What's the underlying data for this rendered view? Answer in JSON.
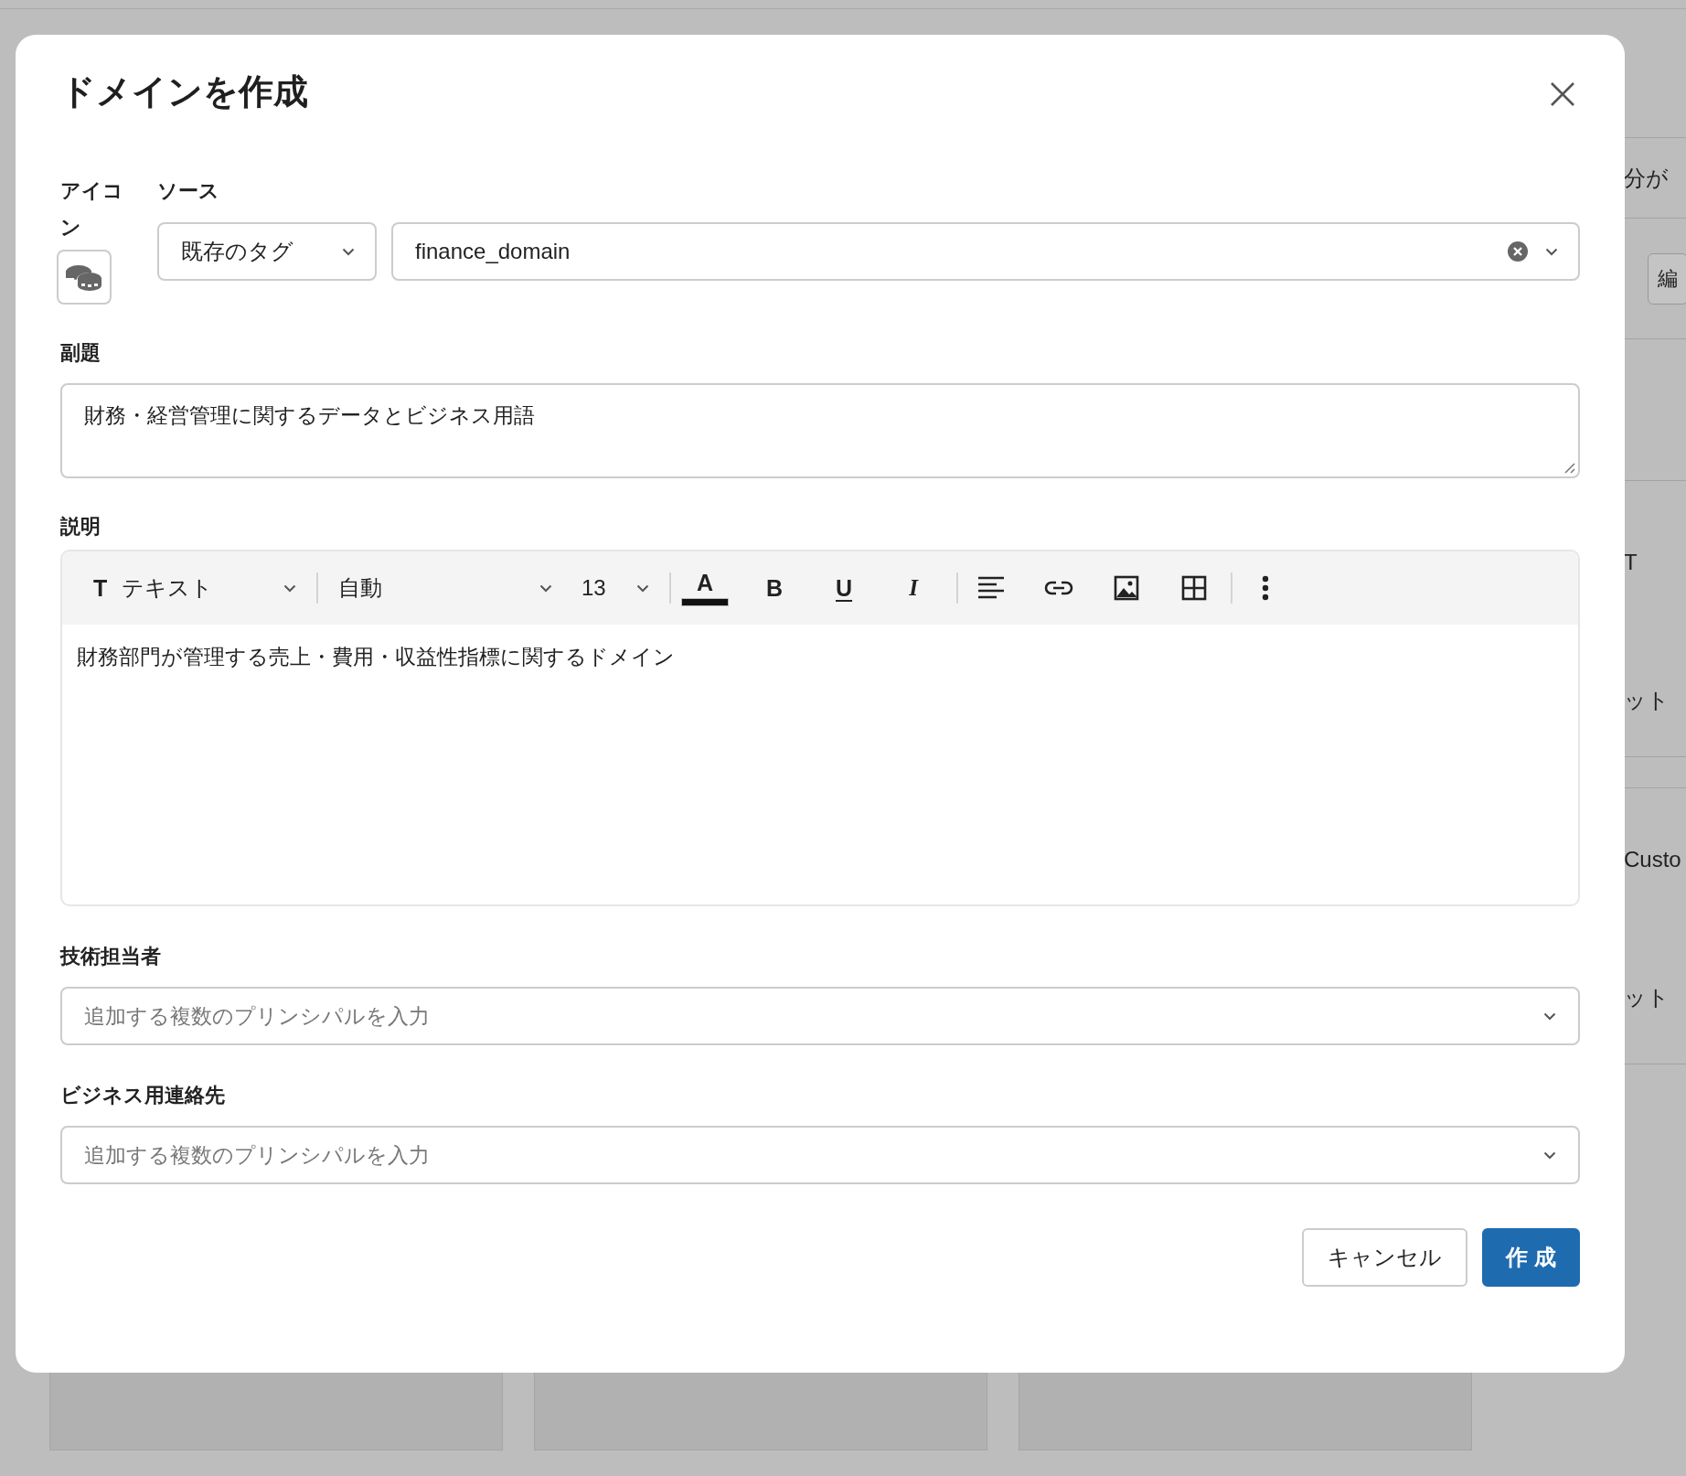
{
  "background_page": {
    "side_items": [
      {
        "kind": "text",
        "text": "分が"
      },
      {
        "kind": "button",
        "text": "編"
      },
      {
        "kind": "blank"
      },
      {
        "kind": "text",
        "text": "T"
      },
      {
        "kind": "text",
        "text": "ット"
      },
      {
        "kind": "blank"
      },
      {
        "kind": "text",
        "text": "Custo"
      },
      {
        "kind": "text",
        "text": "ット"
      }
    ],
    "cards": [
      {
        "kind": "card"
      },
      {
        "kind": "card"
      },
      {
        "kind": "card"
      }
    ]
  },
  "dialog": {
    "title": "ドメインを作成",
    "icon_label": "アイコン",
    "source_label": "ソース",
    "source_select": {
      "value": "既存のタグ"
    },
    "tag_field": {
      "value": "finance_domain"
    },
    "subtitle": {
      "label": "副題",
      "value": "財務・経営管理に関するデータとビジネス用語"
    },
    "description": {
      "label": "説明",
      "toolbar": [
        {
          "kind": "dropdown",
          "glyph": "T",
          "label": "テキスト"
        },
        {
          "kind": "dropdown",
          "label": "自動"
        },
        {
          "kind": "dropdown",
          "label": "13"
        },
        {
          "kind": "color",
          "glyph": "A"
        },
        {
          "kind": "bold",
          "glyph": "B"
        },
        {
          "kind": "underline",
          "glyph": "U"
        },
        {
          "kind": "italic",
          "glyph": "I"
        },
        {
          "kind": "align"
        },
        {
          "kind": "link"
        },
        {
          "kind": "image"
        },
        {
          "kind": "table"
        },
        {
          "kind": "more"
        }
      ],
      "value": "財務部門が管理する売上・費用・収益性指標に関するドメイン"
    },
    "technical_owner": {
      "label": "技術担当者",
      "placeholder": "追加する複数のプリンシパルを入力"
    },
    "business_contact": {
      "label": "ビジネス用連絡先",
      "placeholder": "追加する複数のプリンシパルを入力"
    },
    "buttons": [
      {
        "label": "キャンセル",
        "kind": "secondary"
      },
      {
        "label": "作 成",
        "kind": "primary"
      }
    ]
  }
}
